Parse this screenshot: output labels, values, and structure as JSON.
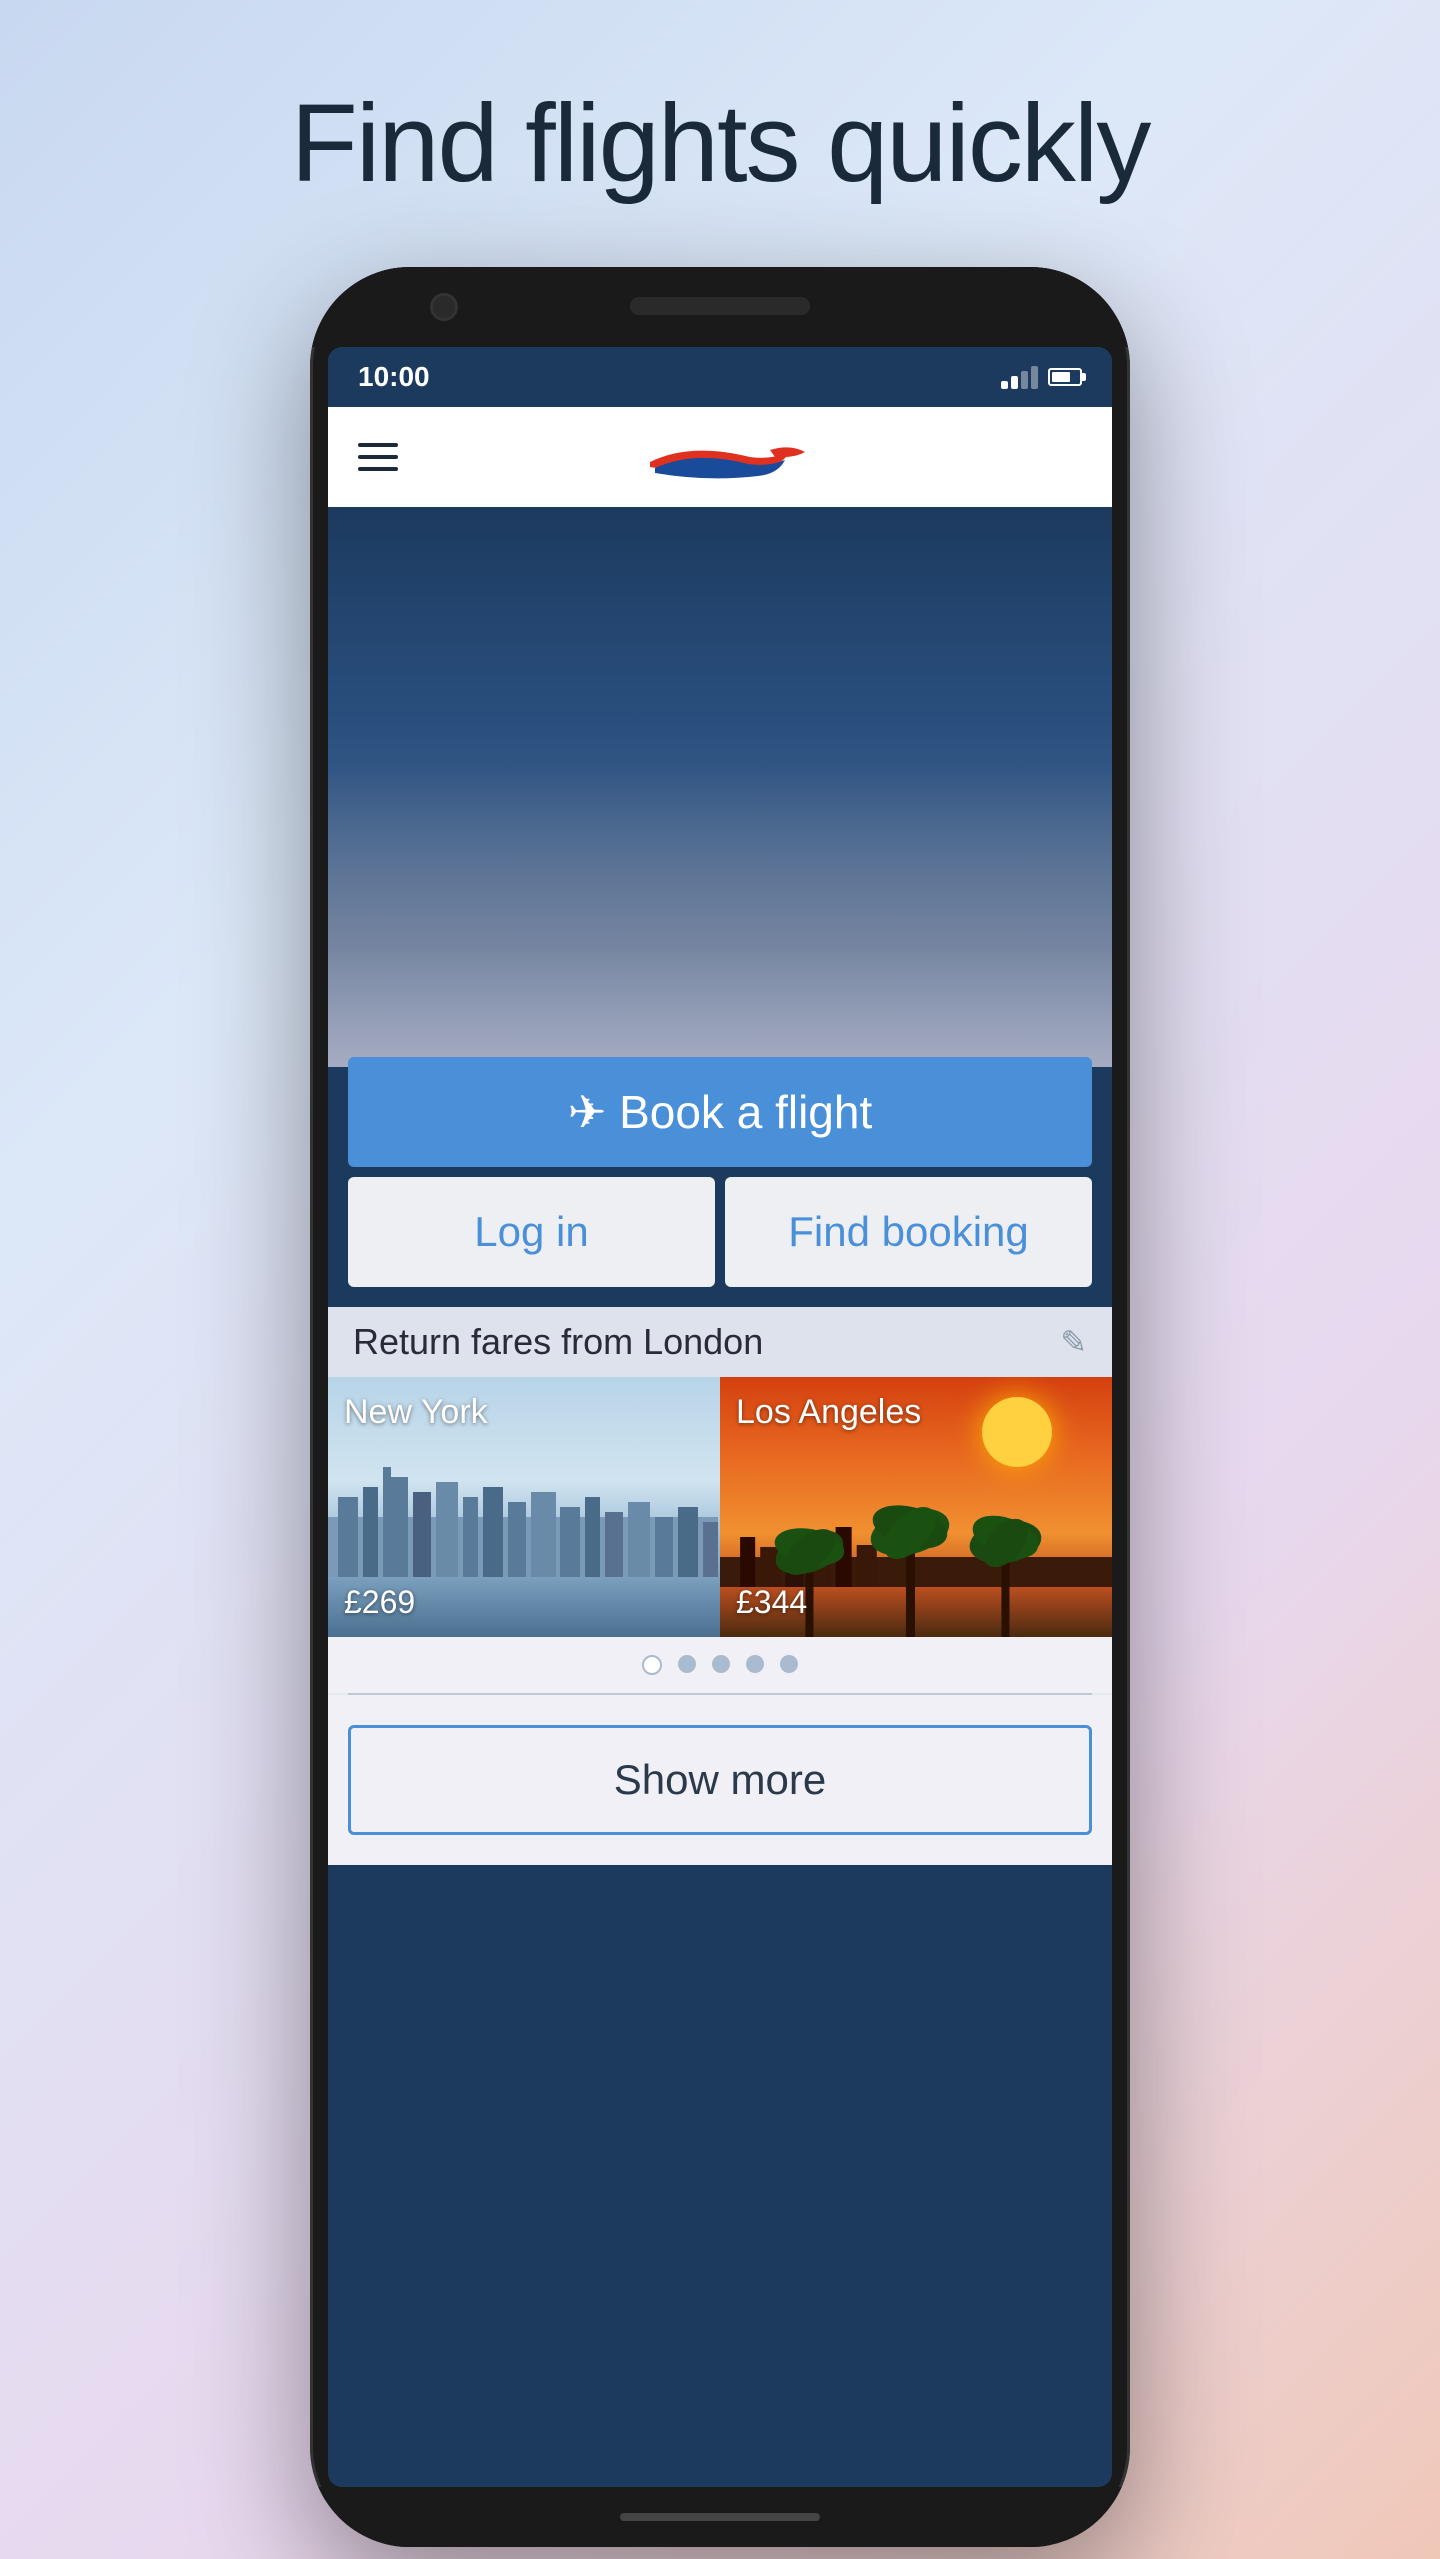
{
  "page": {
    "headline": "Find flights quickly"
  },
  "status_bar": {
    "time": "10:00"
  },
  "header": {
    "menu_label": "Menu"
  },
  "hero": {
    "book_flight_label": "✈ Book a flight",
    "login_label": "Log in",
    "find_booking_label": "Find booking"
  },
  "fares": {
    "section_title": "Return fares from London",
    "destinations": [
      {
        "name": "New York",
        "price": "£269"
      },
      {
        "name": "Los Angeles",
        "price": "£344"
      }
    ],
    "carousel_dots": [
      true,
      false,
      false,
      false,
      false
    ]
  },
  "show_more": {
    "label": "Show more"
  }
}
